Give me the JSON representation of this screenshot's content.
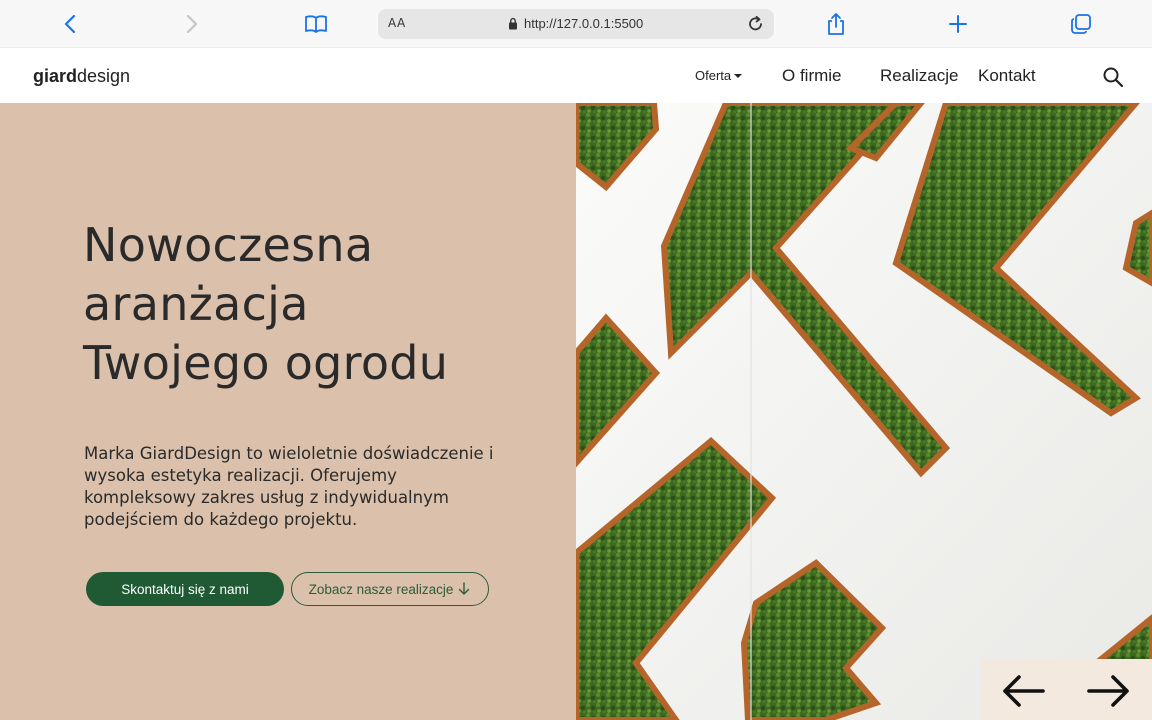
{
  "browser": {
    "aa_label": "AA",
    "url": "http://127.0.0.1:5500"
  },
  "header": {
    "logo_bold": "giard",
    "logo_rest": "design",
    "nav": {
      "oferta": "Oferta",
      "o_firmie": "O firmie",
      "realizacje": "Realizacje",
      "kontakt": "Kontakt"
    }
  },
  "hero": {
    "title_lines": [
      "Nowoczesna",
      "aranżacja",
      "Twojego ogrodu"
    ],
    "description": "Marka GiardDesign to wieloletnie doświadczenie i wysoka estetyka realizacji. Oferujemy kompleksowy zakres usług z indywidualnym podejściem do każdego projektu.",
    "primary_button": "Skontaktuj się z nami",
    "secondary_button": "Zobacz nasze realizacje"
  },
  "colors": {
    "hero_bg": "#dbc1ab",
    "primary_green": "#1f5a34",
    "hedge_green": "#3f6b22",
    "planter_rust": "#b5652a"
  }
}
